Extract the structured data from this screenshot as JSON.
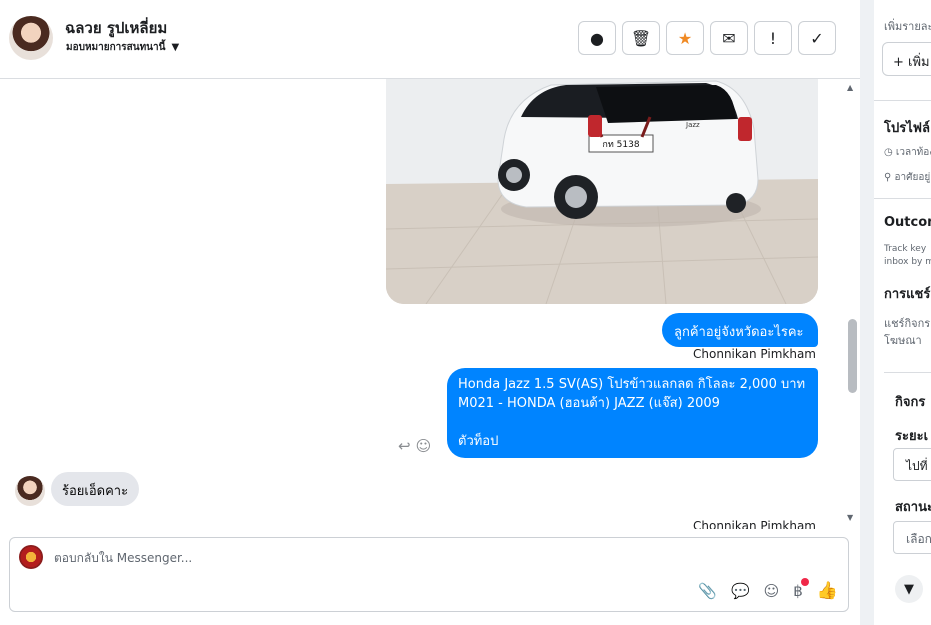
{
  "header": {
    "contact_name": "ฉลวย รูปเหลี่ยม",
    "assign_label": "มอบหมายการสนทนานี้",
    "toolbar": [
      {
        "icon": "alert-circle-icon",
        "glyph": "❗"
      },
      {
        "icon": "trash-icon",
        "glyph": "🗑"
      },
      {
        "icon": "star-icon",
        "glyph": "★"
      },
      {
        "icon": "envelope-icon",
        "glyph": "✉"
      },
      {
        "icon": "exclamation-icon",
        "glyph": "!"
      },
      {
        "icon": "check-icon",
        "glyph": "✓"
      }
    ]
  },
  "thread": {
    "messages": [
      {
        "direction": "out",
        "text": "ลูกค้าอยู่จังหวัดอะไรคะ",
        "sender": "Chonnikan Pimkham"
      },
      {
        "direction": "out",
        "lines": [
          "Honda Jazz 1.5 SV(AS) โปรข้าวแลกลด กิโลละ 2,000 บาท",
          "M021 - HONDA (ฮอนด้า) JAZZ (แจ๊ส) 2009",
          "ตัวท็อป"
        ]
      },
      {
        "direction": "in",
        "text": "ร้อยเอ็ดคาะ"
      }
    ],
    "trailing_sender": "Chonnikan Pimkham",
    "car_plate": "กท 5138",
    "car_badge": "Jazz"
  },
  "composer": {
    "placeholder": "ตอบกลับใน Messenger..."
  },
  "side": {
    "add_detail": "เพิ่มรายละเอียด",
    "add_button": "+ เพิ่ม",
    "profile_title": "โปรไฟล์",
    "local_time": "เวลาท้องถิ่น",
    "address": "อาศัยอยู่",
    "outcomes_title": "Outcomes",
    "outcomes_desc_1": "Track key",
    "outcomes_desc_2": "inbox by m",
    "share_title": "การแชร์",
    "share_desc_1": "แชร์กิจกร",
    "share_desc_2": "โฆษณา",
    "activity_title": "กิจกร",
    "period_label": "ระยะเ",
    "period_value": "ไปที่",
    "status_label": "สถานะ",
    "status_value": "เลือก"
  },
  "colors": {
    "outgoing_bubble": "#0084ff",
    "incoming_bubble": "#e4e6eb",
    "star": "#f08a24",
    "notify_dot": "#f02849"
  }
}
